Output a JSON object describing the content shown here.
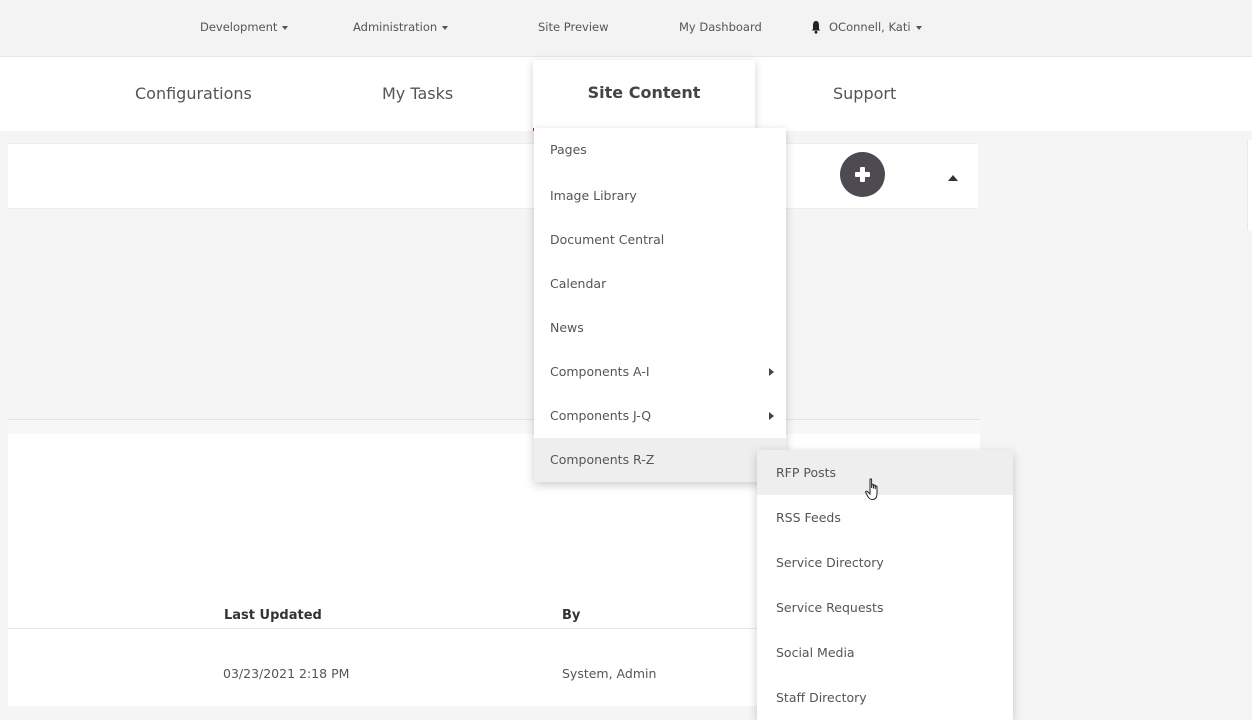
{
  "topbar": {
    "development": "Development",
    "administration": "Administration",
    "site_preview": "Site Preview",
    "my_dashboard": "My Dashboard",
    "user": "OConnell, Kati"
  },
  "mainnav": {
    "configurations": "Configurations",
    "my_tasks": "My Tasks",
    "site_content": "Site Content",
    "support": "Support"
  },
  "site_content_menu": {
    "items": [
      "Pages",
      "Image Library",
      "Document Central",
      "Calendar",
      "News",
      "Components A-I",
      "Components J-Q",
      "Components R-Z"
    ]
  },
  "components_rz_submenu": {
    "items": [
      "RFP Posts",
      "RSS Feeds",
      "Service Directory",
      "Service Requests",
      "Social Media",
      "Staff Directory"
    ]
  },
  "table": {
    "headers": {
      "last_updated": "Last Updated",
      "by": "By"
    },
    "rows": [
      {
        "last_updated": "03/23/2021 2:18 PM",
        "by": "System, Admin"
      }
    ]
  },
  "colors": {
    "accent": "#b7293e",
    "add_button": "#4d4a52"
  }
}
